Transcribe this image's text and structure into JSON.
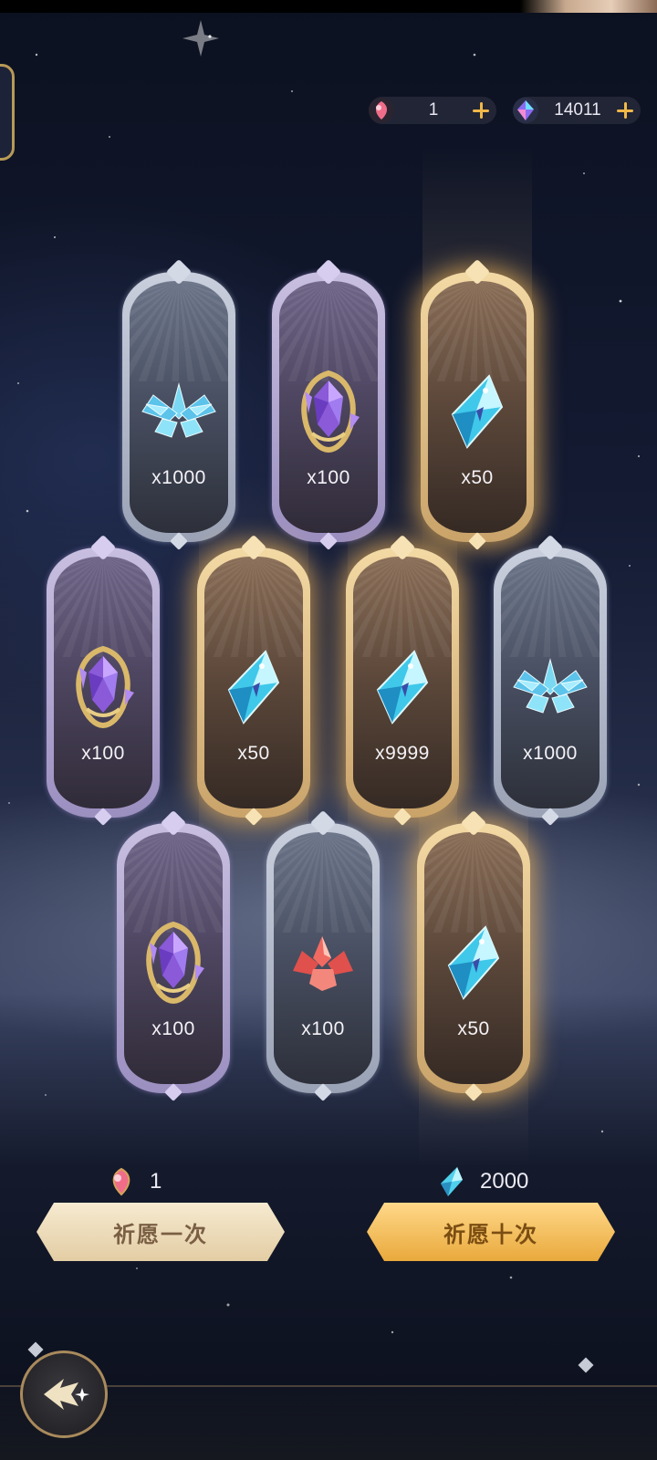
{
  "currencies": {
    "wish_token": {
      "icon": "pink-gem-icon",
      "value": "1"
    },
    "crystal": {
      "icon": "rainbow-crystal-icon",
      "value": "14011"
    }
  },
  "rewards": [
    {
      "rarity": "silver",
      "item": "ice-crystal-cluster-icon",
      "qty": "x1000"
    },
    {
      "rarity": "purple",
      "item": "amethyst-ornament-icon",
      "qty": "x100"
    },
    {
      "rarity": "gold",
      "item": "blue-diamond-crystal-icon",
      "qty": "x50"
    },
    {
      "rarity": "purple",
      "item": "amethyst-ornament-icon",
      "qty": "x100"
    },
    {
      "rarity": "gold",
      "item": "blue-diamond-crystal-icon",
      "qty": "x50"
    },
    {
      "rarity": "gold",
      "item": "blue-diamond-crystal-icon",
      "qty": "x9999"
    },
    {
      "rarity": "silver",
      "item": "ice-crystal-cluster-icon",
      "qty": "x1000"
    },
    {
      "rarity": "purple",
      "item": "amethyst-ornament-icon",
      "qty": "x100"
    },
    {
      "rarity": "silver",
      "item": "red-crystal-cluster-icon",
      "qty": "x100"
    },
    {
      "rarity": "gold",
      "item": "blue-diamond-crystal-icon",
      "qty": "x50"
    }
  ],
  "pull_once": {
    "cost_icon": "pink-gem-icon",
    "cost": "1",
    "label": "祈愿一次"
  },
  "pull_ten": {
    "cost_icon": "blue-diamond-crystal-icon",
    "cost": "2000",
    "label": "祈愿十次"
  },
  "back_icon": "back-arrow-icon",
  "colors": {
    "gold_glow": "#ffbe5a",
    "plus_accent": "#f0b848",
    "gold_button": "#f0b24a",
    "plain_button": "#efe0c2"
  }
}
